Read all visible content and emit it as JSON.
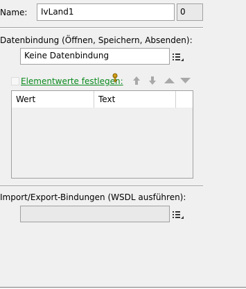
{
  "name": {
    "label": "Name:",
    "value": "IvLand1",
    "count": "0"
  },
  "binding": {
    "label": "Datenbindung (Öffnen, Speichern, Absenden):",
    "value": "Keine Datenbindung",
    "set_values_link": "Elementwerte festlegen:",
    "table_headers": [
      "Wert",
      "Text"
    ]
  },
  "import_export": {
    "label": "Import/Export-Bindungen (WSDL ausführen):",
    "value": ""
  },
  "icons": [
    "list-menu-icon",
    "key-icon",
    "arrow-up-icon",
    "arrow-down-icon",
    "triangle-up-icon",
    "triangle-down-icon"
  ],
  "colors": {
    "link": "#0a8a1e",
    "background": "#f0f0f0",
    "border": "#a0a0a0"
  }
}
